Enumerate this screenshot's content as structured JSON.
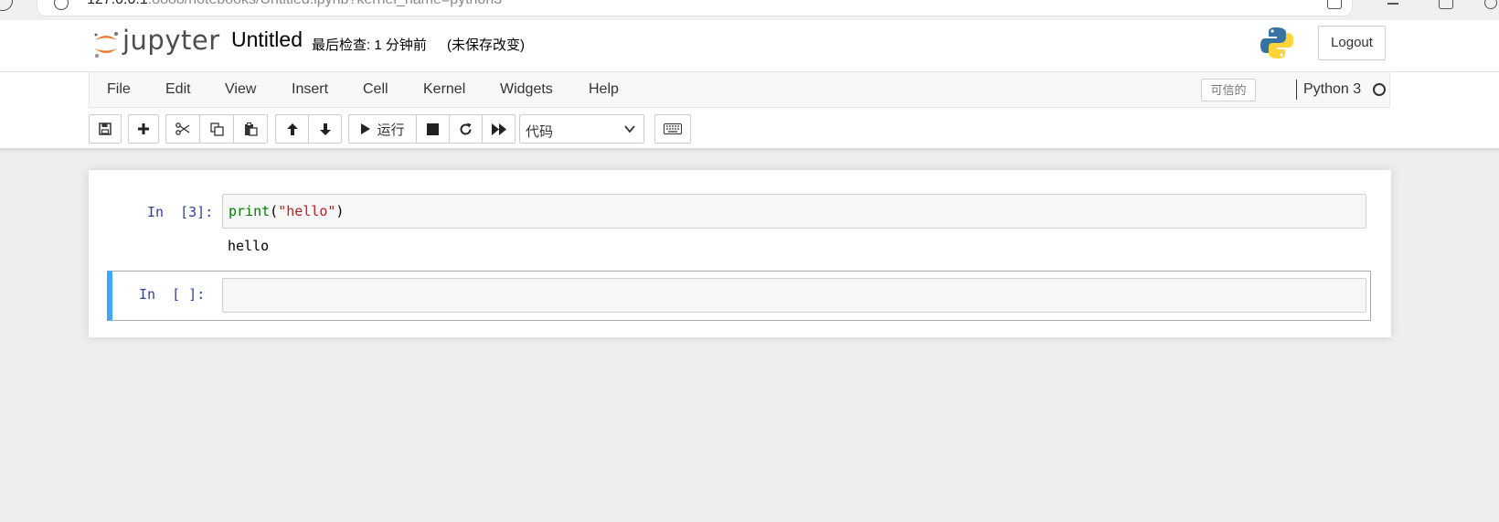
{
  "browser": {
    "url_main": "127.0.0.1",
    "url_dim": ":8888/notebooks/Untitled.ipynb?kernel_name=python3"
  },
  "header": {
    "logo_text": "jupyter",
    "notebook_title": "Untitled",
    "checkpoint": "最后检查: 1 分钟前",
    "autosave_status": "(未保存改变)",
    "logout_label": "Logout"
  },
  "menubar": {
    "items": [
      "File",
      "Edit",
      "View",
      "Insert",
      "Cell",
      "Kernel",
      "Widgets",
      "Help"
    ],
    "trusted_label": "可信的",
    "kernel_name": "Python 3"
  },
  "toolbar": {
    "buttons": [
      "save-icon",
      "plus-icon",
      "cut-icon",
      "copy-icon",
      "paste-icon",
      "arrow-up-icon",
      "arrow-down-icon",
      "play-icon",
      "stop-icon",
      "restart-icon",
      "fast-forward-icon",
      "keyboard-icon"
    ],
    "run_label": "运行",
    "cell_type": "代码"
  },
  "cells": [
    {
      "prompt": "In  [3]:",
      "code_fn": "print",
      "code_open": "(",
      "code_str": "\"hello\"",
      "code_close": ")",
      "output": "hello"
    },
    {
      "prompt": "In  [ ]:",
      "code": ""
    }
  ],
  "colors": {
    "selected_cell_border": "#42a5f5",
    "prompt": "#303f9f",
    "jupyter_orange": "#f37726"
  }
}
